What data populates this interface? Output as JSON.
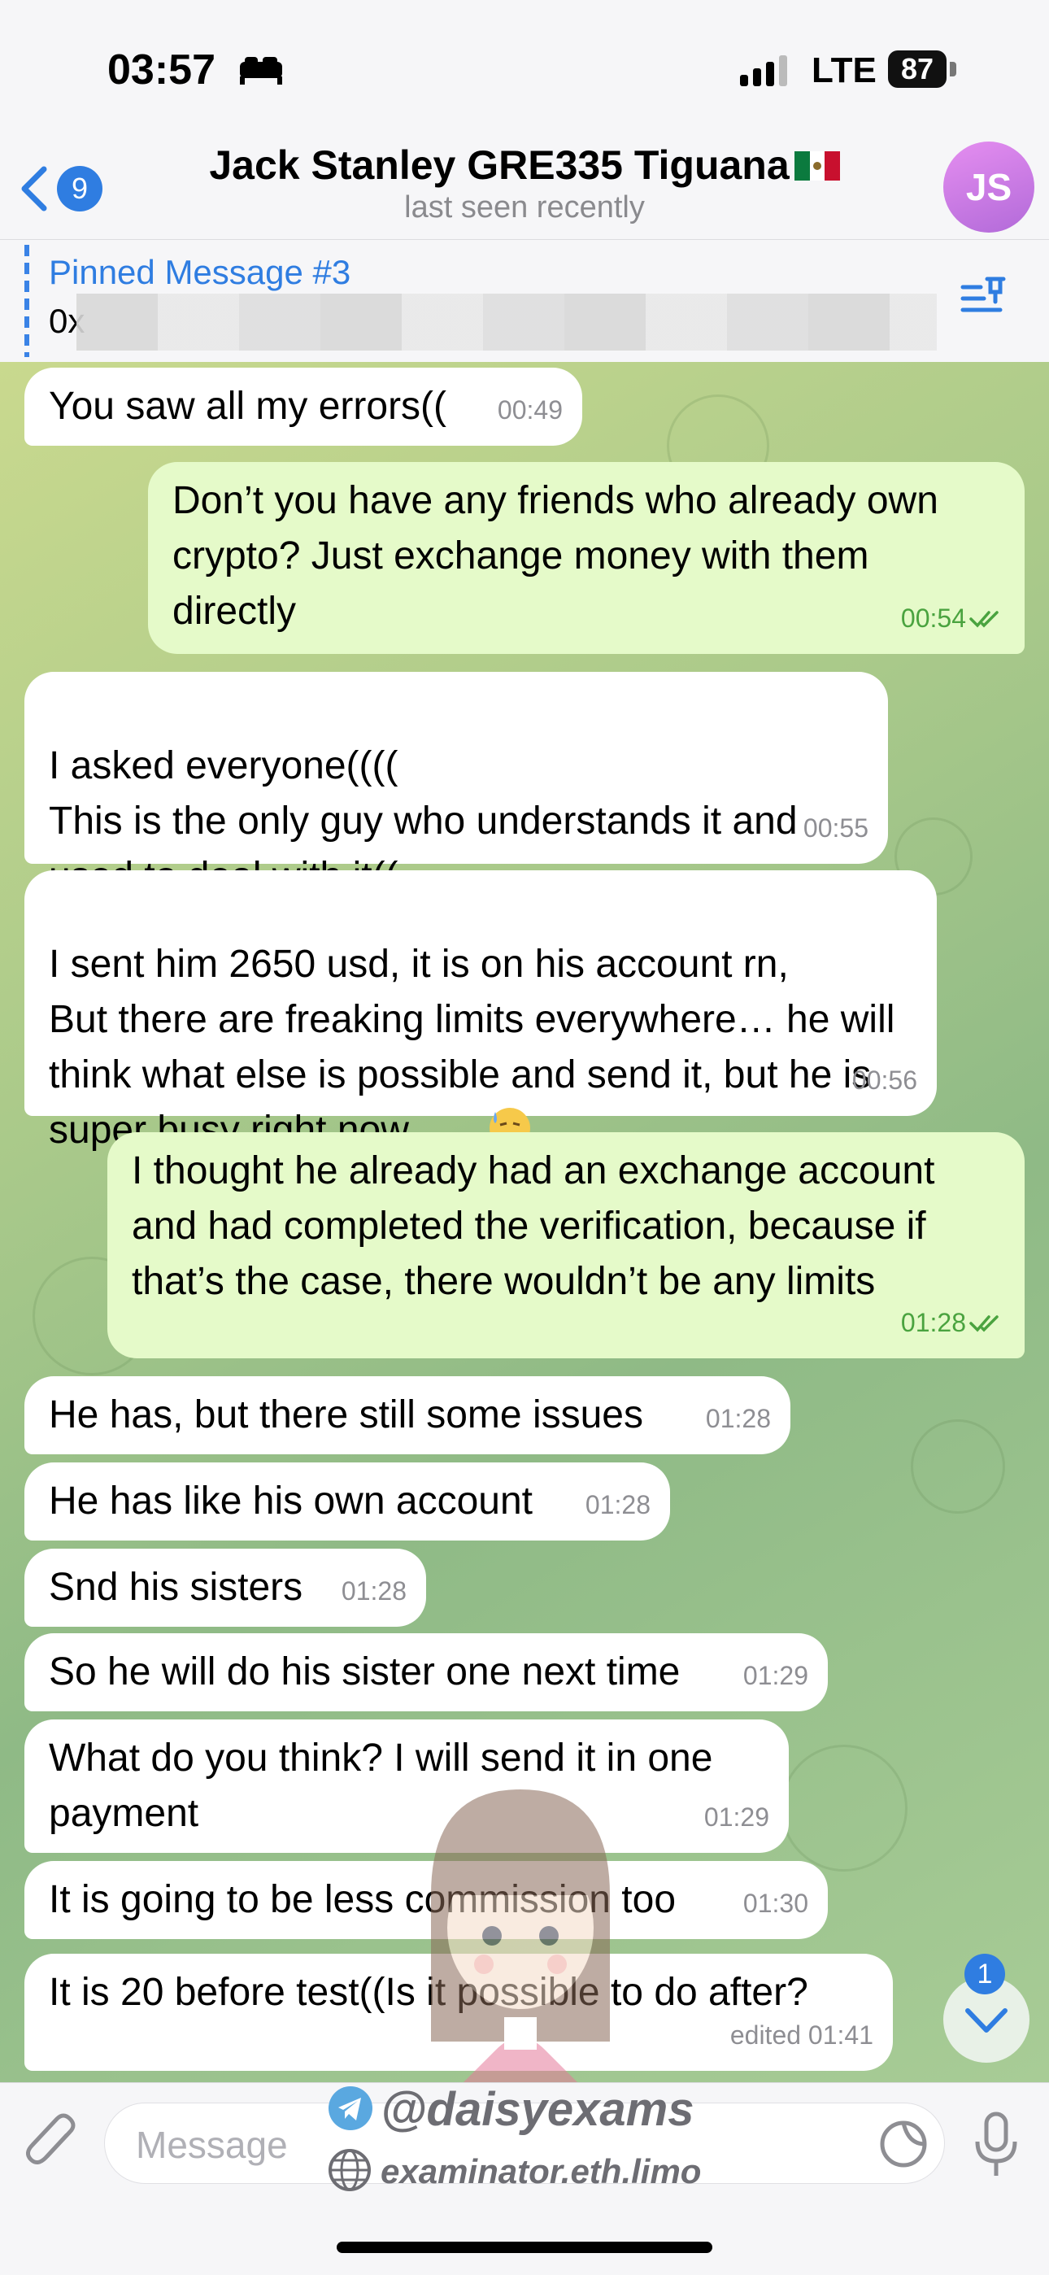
{
  "status_bar": {
    "time": "03:57",
    "network": "LTE",
    "battery": "87"
  },
  "header": {
    "back_badge": "9",
    "title": "Jack Stanley GRE335 Tiguana",
    "subtitle": "last seen recently",
    "avatar_initials": "JS"
  },
  "pinned": {
    "title": "Pinned Message #3",
    "text": "0x"
  },
  "messages": [
    {
      "text": "You saw all my errors((",
      "time": "00:49"
    },
    {
      "text": "Don’t you have any friends who already own crypto? Just exchange money with them directly",
      "time": "00:54"
    },
    {
      "text": "I asked everyone((((\nThis is the only guy who understands it and used to deal with it((",
      "time": "00:55"
    },
    {
      "text": "I sent him 2650 usd, it is on his account rn,\nBut there are freaking limits everywhere… he will think what else is possible and send it, but he is super busy right now……",
      "time": "00:56"
    },
    {
      "text": "I thought he already had an exchange account and had completed the verification, because if that’s the case, there wouldn’t be any limits",
      "time": "01:28"
    },
    {
      "text": "He has, but there still some issues",
      "time": "01:28"
    },
    {
      "text": "He has like his own account",
      "time": "01:28"
    },
    {
      "text": "Snd his sisters",
      "time": "01:28"
    },
    {
      "text": "So he will do his sister one next time",
      "time": "01:29"
    },
    {
      "text": "What do you think? I will send it in one payment",
      "time": "01:29"
    },
    {
      "text": "It is going to be less commission too",
      "time": "01:30"
    },
    {
      "text": "It is 20 before test((Is it possible to do after?",
      "time": "edited 01:41"
    }
  ],
  "scroll_badge": "1",
  "composer": {
    "placeholder": "Message"
  },
  "watermark": {
    "handle": "@daisyexams",
    "site": "examinator.eth.limo"
  },
  "colors": {
    "accent": "#2f7de1",
    "outgoing_bubble": "#e5fac9",
    "incoming_bubble": "#ffffff"
  }
}
